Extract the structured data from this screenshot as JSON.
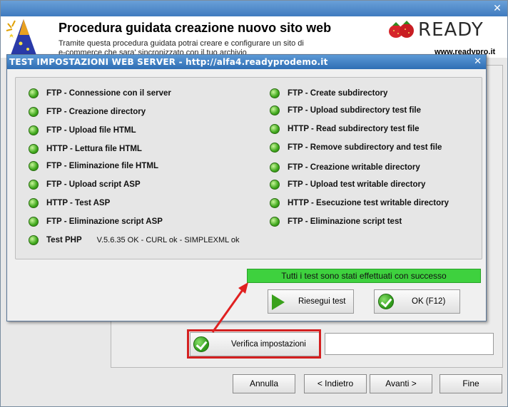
{
  "wizard": {
    "title": "Procedura guidata creazione nuovo sito web",
    "desc_line1": "Tramite questa procedura guidata potrai creare e configurare un sito di",
    "desc_line2": "e-commerce che sara' sincronizzato con il tuo archivio",
    "logo_text": "READY",
    "logo_url": "www.readypro.it",
    "verify_label": "Verifica impostazioni",
    "verify_value": "",
    "nav": {
      "cancel": "Annulla",
      "back": "< Indietro",
      "next": "Avanti >",
      "finish": "Fine"
    }
  },
  "dialog": {
    "title": "TEST IMPOSTAZIONI WEB SERVER - http://alfa4.readyprodemo.it",
    "left_tests": [
      "FTP - Connessione con il server",
      "FTP - Creazione directory",
      "FTP - Upload file HTML",
      "HTTP - Lettura file HTML",
      "FTP - Eliminazione file HTML",
      "FTP - Upload script ASP",
      "HTTP - Test ASP",
      "FTP - Eliminazione script ASP",
      "Test PHP"
    ],
    "php_detail": "V.5.6.35 OK - CURL ok - SIMPLEXML ok",
    "right_tests": [
      "FTP - Create subdirectory",
      "FTP - Upload subdirectory test file",
      "HTTP - Read subdirectory test file",
      "FTP - Remove subdirectory and test file",
      "FTP - Creazione writable directory",
      "FTP - Upload test writable directory",
      "HTTP - Esecuzione test writable directory",
      "FTP - Eliminazione script test"
    ],
    "status_message": "Tutti i test sono stati effettuati con successo",
    "retry_label": "Riesegui test",
    "ok_label": "OK (F12)"
  },
  "colors": {
    "led_ok": "#3fa81c",
    "success_bar": "#3ed13e",
    "highlight": "#d42020",
    "titlebar": "#2f6eb4"
  }
}
